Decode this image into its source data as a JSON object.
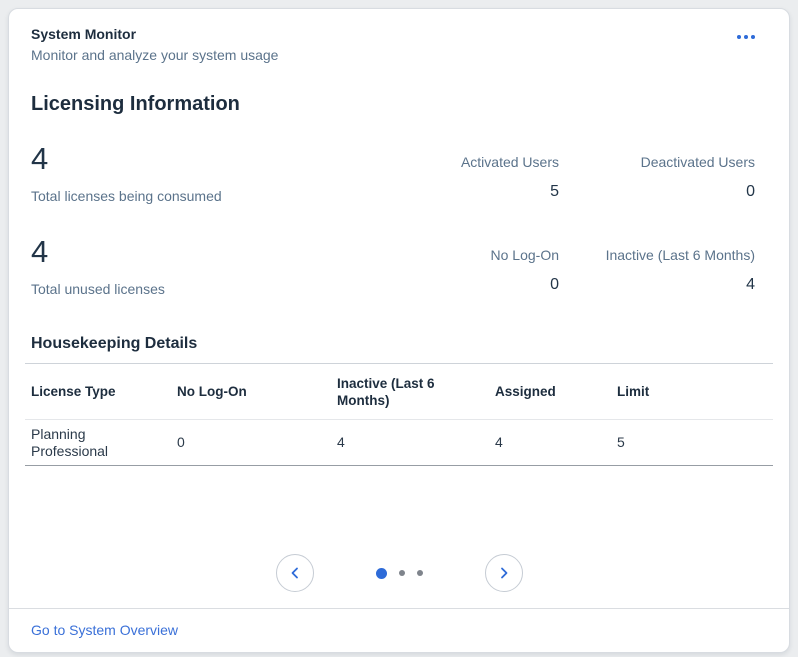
{
  "card": {
    "title": "System Monitor",
    "subtitle": "Monitor and analyze your system usage",
    "menu_icon": "ellipsis-icon",
    "section_title": "Licensing Information",
    "stats": [
      {
        "big_value": "4",
        "big_label": "Total licenses being consumed",
        "metrics": [
          {
            "label": "Activated Users",
            "value": "5"
          },
          {
            "label": "Deactivated Users",
            "value": "0"
          }
        ]
      },
      {
        "big_value": "4",
        "big_label": "Total unused licenses",
        "metrics": [
          {
            "label": "No Log-On",
            "value": "0"
          },
          {
            "label": "Inactive (Last 6 Months)",
            "value": "4"
          }
        ]
      }
    ],
    "housekeeping": {
      "title": "Housekeeping Details",
      "table": {
        "columns": [
          "License Type",
          "No Log-On",
          "Inactive (Last 6 Months)",
          "Assigned",
          "Limit"
        ],
        "rows": [
          [
            "Planning Professional",
            "0",
            "4",
            "4",
            "5"
          ]
        ]
      }
    },
    "carousel": {
      "prev_icon": "chevron-left-icon",
      "next_icon": "chevron-right-icon",
      "dots_total": 3,
      "active_dot": 1
    },
    "footer_link": "Go to System Overview"
  },
  "colors": {
    "accent_blue": "#2E6BD8",
    "link_blue": "#3A70D8",
    "title_navy": "#1D2D3E",
    "label_gray": "#5B738B",
    "value_dark": "#223548",
    "page_bg": "#EBEDEF",
    "card_bg": "#FFFFFF",
    "row_divider": "#979DA4"
  }
}
